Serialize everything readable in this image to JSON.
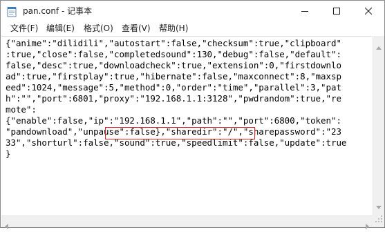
{
  "window": {
    "title": "pan.conf - 记事本",
    "icon": "notepad-icon"
  },
  "menu": {
    "items": [
      {
        "label": "文件(F)"
      },
      {
        "label": "编辑(E)"
      },
      {
        "label": "格式(O)"
      },
      {
        "label": "查看(V)"
      },
      {
        "label": "帮助(H)"
      }
    ]
  },
  "editor": {
    "lines": [
      "{\"anime\":\"dilidili\",\"autostart\":false,\"checksum\":true,\"clipboard\"",
      ":true,\"close\":false,\"completedsound\":130,\"debug\":false,\"default\":",
      "false,\"desc\":true,\"downloadcheck\":true,\"extension\":0,\"firstdownlo",
      "ad\":true,\"firstplay\":true,\"hibernate\":false,\"maxconnect\":8,\"maxsp",
      "eed\":1024,\"message\":5,\"method\":0,\"order\":\"time\",\"parallel\":3,\"pat",
      "h\":\"\",\"port\":6801,\"proxy\":\"192.168.1.1:3128\",\"pwdrandom\":true,\"re",
      "mote\":",
      "{\"enable\":false,\"ip\":\"192.168.1.1\",\"path\":\"\",\"port\":6800,\"token\":",
      "\"pandownload\",\"unpause\":false},\"sharedir\":\"/\",\"sharepassword\":\"23",
      "33\",\"shorturl\":false,\"sound\":true,\"speedlimit\":false,\"update\":true",
      "}"
    ],
    "highlight_text": "\"proxy\":\"192.168.1.1:3128\"",
    "highlight_color": "#e0231f"
  }
}
